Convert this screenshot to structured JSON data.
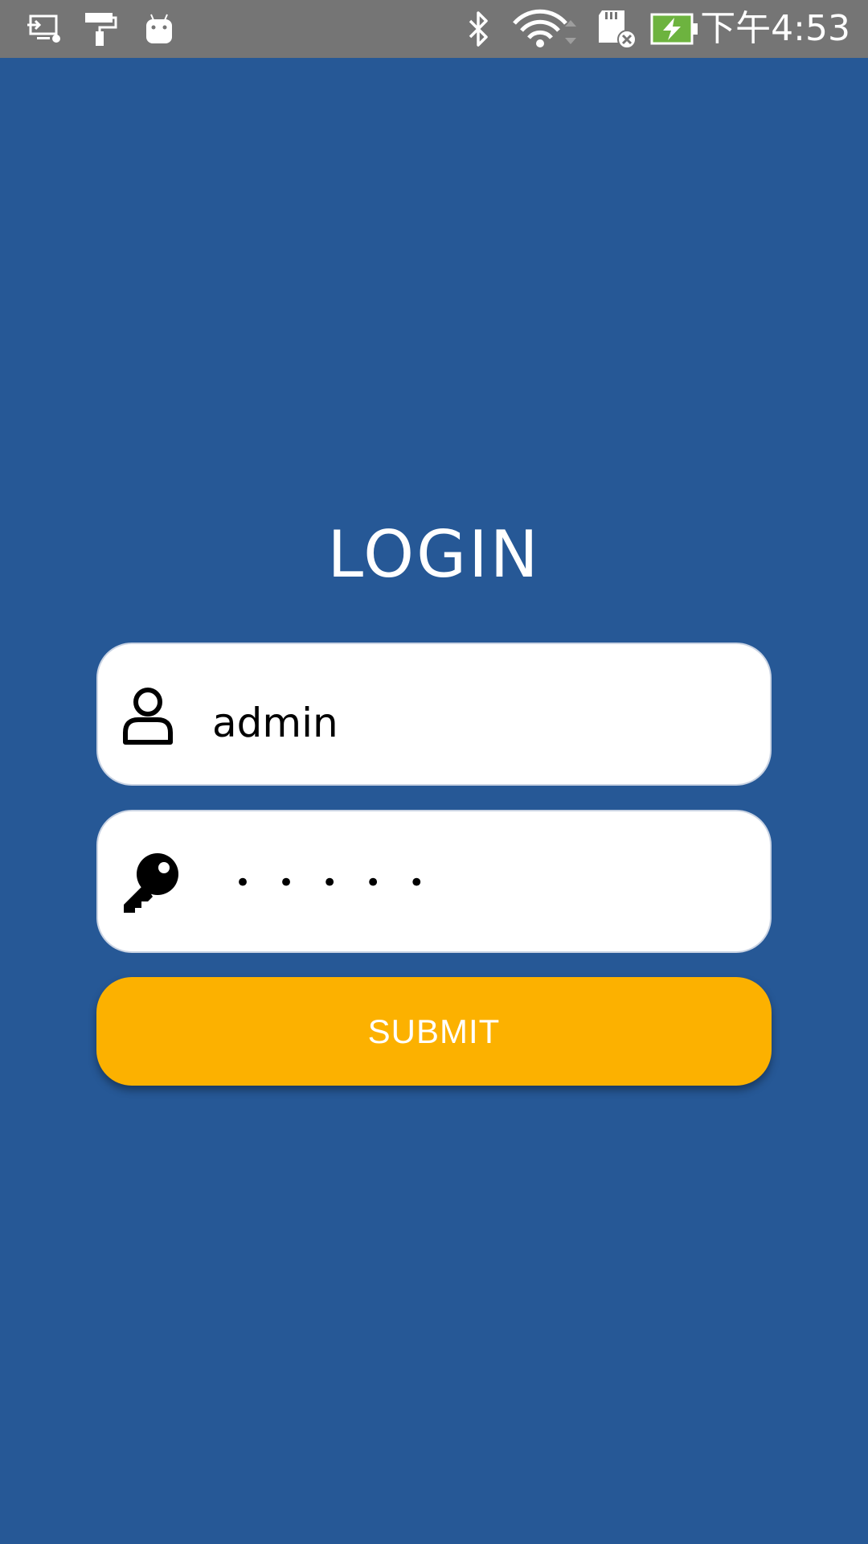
{
  "status_bar": {
    "time": "下午4:53",
    "icons": [
      "screen-cast-icon",
      "paint-roller-icon",
      "android-icon",
      "bluetooth-icon",
      "wifi-icon",
      "sd-card-error-icon",
      "battery-charging-icon"
    ]
  },
  "login": {
    "title": "LOGIN",
    "username": {
      "icon": "user-icon",
      "value": "admin"
    },
    "password": {
      "icon": "key-icon",
      "masked_value": "•••••"
    },
    "submit_label": "SUBMIT"
  },
  "colors": {
    "background": "#265896",
    "status_bar": "#757575",
    "accent_button": "#FCB100",
    "field_bg": "#FFFFFF",
    "battery_fill": "#6DB33F"
  }
}
